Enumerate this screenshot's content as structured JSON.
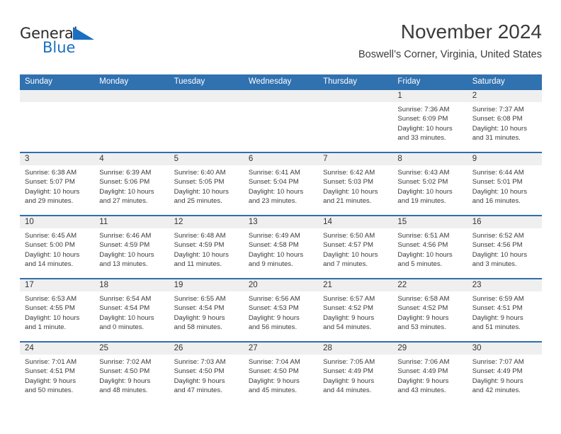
{
  "logo": {
    "text_top": "General",
    "text_bottom": "Blue",
    "triangle_icon": "triangle-icon",
    "color_blue": "#1b6fc2",
    "color_dark": "#2b2b2b"
  },
  "header": {
    "title": "November 2024",
    "subtitle": "Boswell’s Corner, Virginia, United States"
  },
  "theme": {
    "header_blue": "#3071b0",
    "row_rule_blue": "#2f6fae",
    "daynum_bg": "#efefef"
  },
  "calendar": {
    "weekday_headers": [
      "Sunday",
      "Monday",
      "Tuesday",
      "Wednesday",
      "Thursday",
      "Friday",
      "Saturday"
    ],
    "weeks": [
      [
        {
          "day": "",
          "empty": true
        },
        {
          "day": "",
          "empty": true
        },
        {
          "day": "",
          "empty": true
        },
        {
          "day": "",
          "empty": true
        },
        {
          "day": "",
          "empty": true
        },
        {
          "day": "1",
          "sunrise": "Sunrise: 7:36 AM",
          "sunset": "Sunset: 6:09 PM",
          "daylight1": "Daylight: 10 hours",
          "daylight2": "and 33 minutes."
        },
        {
          "day": "2",
          "sunrise": "Sunrise: 7:37 AM",
          "sunset": "Sunset: 6:08 PM",
          "daylight1": "Daylight: 10 hours",
          "daylight2": "and 31 minutes."
        }
      ],
      [
        {
          "day": "3",
          "sunrise": "Sunrise: 6:38 AM",
          "sunset": "Sunset: 5:07 PM",
          "daylight1": "Daylight: 10 hours",
          "daylight2": "and 29 minutes."
        },
        {
          "day": "4",
          "sunrise": "Sunrise: 6:39 AM",
          "sunset": "Sunset: 5:06 PM",
          "daylight1": "Daylight: 10 hours",
          "daylight2": "and 27 minutes."
        },
        {
          "day": "5",
          "sunrise": "Sunrise: 6:40 AM",
          "sunset": "Sunset: 5:05 PM",
          "daylight1": "Daylight: 10 hours",
          "daylight2": "and 25 minutes."
        },
        {
          "day": "6",
          "sunrise": "Sunrise: 6:41 AM",
          "sunset": "Sunset: 5:04 PM",
          "daylight1": "Daylight: 10 hours",
          "daylight2": "and 23 minutes."
        },
        {
          "day": "7",
          "sunrise": "Sunrise: 6:42 AM",
          "sunset": "Sunset: 5:03 PM",
          "daylight1": "Daylight: 10 hours",
          "daylight2": "and 21 minutes."
        },
        {
          "day": "8",
          "sunrise": "Sunrise: 6:43 AM",
          "sunset": "Sunset: 5:02 PM",
          "daylight1": "Daylight: 10 hours",
          "daylight2": "and 19 minutes."
        },
        {
          "day": "9",
          "sunrise": "Sunrise: 6:44 AM",
          "sunset": "Sunset: 5:01 PM",
          "daylight1": "Daylight: 10 hours",
          "daylight2": "and 16 minutes."
        }
      ],
      [
        {
          "day": "10",
          "sunrise": "Sunrise: 6:45 AM",
          "sunset": "Sunset: 5:00 PM",
          "daylight1": "Daylight: 10 hours",
          "daylight2": "and 14 minutes."
        },
        {
          "day": "11",
          "sunrise": "Sunrise: 6:46 AM",
          "sunset": "Sunset: 4:59 PM",
          "daylight1": "Daylight: 10 hours",
          "daylight2": "and 13 minutes."
        },
        {
          "day": "12",
          "sunrise": "Sunrise: 6:48 AM",
          "sunset": "Sunset: 4:59 PM",
          "daylight1": "Daylight: 10 hours",
          "daylight2": "and 11 minutes."
        },
        {
          "day": "13",
          "sunrise": "Sunrise: 6:49 AM",
          "sunset": "Sunset: 4:58 PM",
          "daylight1": "Daylight: 10 hours",
          "daylight2": "and 9 minutes."
        },
        {
          "day": "14",
          "sunrise": "Sunrise: 6:50 AM",
          "sunset": "Sunset: 4:57 PM",
          "daylight1": "Daylight: 10 hours",
          "daylight2": "and 7 minutes."
        },
        {
          "day": "15",
          "sunrise": "Sunrise: 6:51 AM",
          "sunset": "Sunset: 4:56 PM",
          "daylight1": "Daylight: 10 hours",
          "daylight2": "and 5 minutes."
        },
        {
          "day": "16",
          "sunrise": "Sunrise: 6:52 AM",
          "sunset": "Sunset: 4:56 PM",
          "daylight1": "Daylight: 10 hours",
          "daylight2": "and 3 minutes."
        }
      ],
      [
        {
          "day": "17",
          "sunrise": "Sunrise: 6:53 AM",
          "sunset": "Sunset: 4:55 PM",
          "daylight1": "Daylight: 10 hours",
          "daylight2": "and 1 minute."
        },
        {
          "day": "18",
          "sunrise": "Sunrise: 6:54 AM",
          "sunset": "Sunset: 4:54 PM",
          "daylight1": "Daylight: 10 hours",
          "daylight2": "and 0 minutes."
        },
        {
          "day": "19",
          "sunrise": "Sunrise: 6:55 AM",
          "sunset": "Sunset: 4:54 PM",
          "daylight1": "Daylight: 9 hours",
          "daylight2": "and 58 minutes."
        },
        {
          "day": "20",
          "sunrise": "Sunrise: 6:56 AM",
          "sunset": "Sunset: 4:53 PM",
          "daylight1": "Daylight: 9 hours",
          "daylight2": "and 56 minutes."
        },
        {
          "day": "21",
          "sunrise": "Sunrise: 6:57 AM",
          "sunset": "Sunset: 4:52 PM",
          "daylight1": "Daylight: 9 hours",
          "daylight2": "and 54 minutes."
        },
        {
          "day": "22",
          "sunrise": "Sunrise: 6:58 AM",
          "sunset": "Sunset: 4:52 PM",
          "daylight1": "Daylight: 9 hours",
          "daylight2": "and 53 minutes."
        },
        {
          "day": "23",
          "sunrise": "Sunrise: 6:59 AM",
          "sunset": "Sunset: 4:51 PM",
          "daylight1": "Daylight: 9 hours",
          "daylight2": "and 51 minutes."
        }
      ],
      [
        {
          "day": "24",
          "sunrise": "Sunrise: 7:01 AM",
          "sunset": "Sunset: 4:51 PM",
          "daylight1": "Daylight: 9 hours",
          "daylight2": "and 50 minutes."
        },
        {
          "day": "25",
          "sunrise": "Sunrise: 7:02 AM",
          "sunset": "Sunset: 4:50 PM",
          "daylight1": "Daylight: 9 hours",
          "daylight2": "and 48 minutes."
        },
        {
          "day": "26",
          "sunrise": "Sunrise: 7:03 AM",
          "sunset": "Sunset: 4:50 PM",
          "daylight1": "Daylight: 9 hours",
          "daylight2": "and 47 minutes."
        },
        {
          "day": "27",
          "sunrise": "Sunrise: 7:04 AM",
          "sunset": "Sunset: 4:50 PM",
          "daylight1": "Daylight: 9 hours",
          "daylight2": "and 45 minutes."
        },
        {
          "day": "28",
          "sunrise": "Sunrise: 7:05 AM",
          "sunset": "Sunset: 4:49 PM",
          "daylight1": "Daylight: 9 hours",
          "daylight2": "and 44 minutes."
        },
        {
          "day": "29",
          "sunrise": "Sunrise: 7:06 AM",
          "sunset": "Sunset: 4:49 PM",
          "daylight1": "Daylight: 9 hours",
          "daylight2": "and 43 minutes."
        },
        {
          "day": "30",
          "sunrise": "Sunrise: 7:07 AM",
          "sunset": "Sunset: 4:49 PM",
          "daylight1": "Daylight: 9 hours",
          "daylight2": "and 42 minutes."
        }
      ]
    ]
  }
}
